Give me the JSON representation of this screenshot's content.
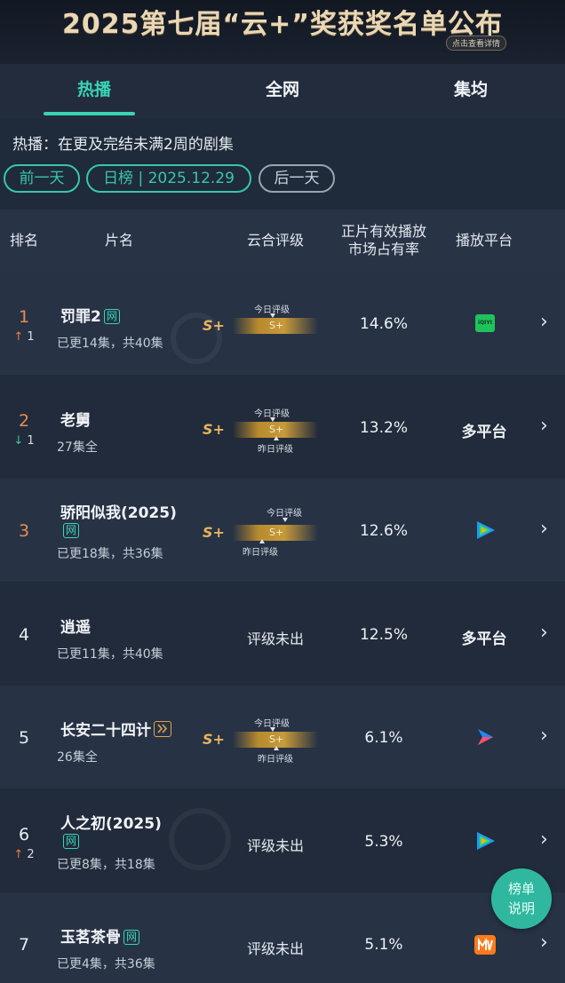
{
  "banner": {
    "title": "2025第七届“云+”奖获奖名单公布",
    "detail": "点击查看详情"
  },
  "tabs": [
    {
      "label": "热播"
    },
    {
      "label": "全网"
    },
    {
      "label": "集均"
    }
  ],
  "description": "热播：在更及完结未满2周的剧集",
  "date_nav": {
    "prev": "前一天",
    "current": "日榜 | 2025.12.29",
    "next": "后一天"
  },
  "table": {
    "headers": {
      "rank": "排名",
      "title": "片名",
      "rating": "云合评级",
      "share": "正片有效播放 市场占有率",
      "platform": "播放平台"
    },
    "today_label": "今日评级",
    "yesterday_label": "昨日评级",
    "rows": [
      {
        "rank": "1",
        "change_dir": "up",
        "change_arrow": "↑",
        "change_value": "1",
        "title": "罚罪2",
        "badge": "网",
        "episodes": "已更14集，共40集",
        "rating": "S+",
        "bar_value": "S+",
        "share": "14.6%",
        "platform": "爱奇艺",
        "platform_icon": "iqiyi-icon",
        "platform_icon_text": "iQIYI"
      },
      {
        "rank": "2",
        "change_dir": "down",
        "change_arrow": "↓",
        "change_value": "1",
        "title": "老舅",
        "badge": "",
        "episodes": "27集全",
        "rating": "S+",
        "bar_value": "S+",
        "share": "13.2%",
        "platform": "多平台"
      },
      {
        "rank": "3",
        "change_dir": "",
        "change_arrow": "",
        "change_value": "",
        "title": "骄阳似我(2025)",
        "badge": "网",
        "episodes": "已更18集，共36集",
        "rating": "S+",
        "bar_value": "S+",
        "share": "12.6%",
        "platform": "腾讯视频",
        "platform_icon": "tencent-video-icon"
      },
      {
        "rank": "4",
        "change_dir": "",
        "change_arrow": "",
        "change_value": "",
        "title": "逍遥",
        "badge": "",
        "episodes": "已更11集，共40集",
        "rating": "评级未出",
        "share": "12.5%",
        "platform": "多平台"
      },
      {
        "rank": "5",
        "change_dir": "",
        "change_arrow": "",
        "change_value": "",
        "title": "长安二十四计",
        "badge": "play",
        "episodes": "26集全",
        "rating": "S+",
        "bar_value": "S+",
        "share": "6.1%",
        "platform": "优酷",
        "platform_icon": "youku-icon"
      },
      {
        "rank": "6",
        "change_dir": "up",
        "change_arrow": "↑",
        "change_value": "2",
        "title": "人之初(2025)",
        "badge": "网",
        "episodes": "已更8集，共18集",
        "rating": "评级未出",
        "share": "5.3%",
        "platform": "腾讯视频",
        "platform_icon": "tencent-video-icon"
      },
      {
        "rank": "7",
        "change_dir": "",
        "change_arrow": "",
        "change_value": "",
        "title": "玉茗茶骨",
        "badge": "网",
        "episodes": "已更4集，共36集",
        "rating": "评级未出",
        "share": "5.1%",
        "platform": "芒果TV",
        "platform_icon": "mango-tv-icon"
      }
    ]
  },
  "legend_button": {
    "line1": "榜单",
    "line2": "说明"
  },
  "colors": {
    "accent": "#3ad3b8",
    "rating_gold": "#e8b45a",
    "rank_top": "#e98d4e",
    "up": "#f07a45",
    "down": "#3ac7a6"
  }
}
